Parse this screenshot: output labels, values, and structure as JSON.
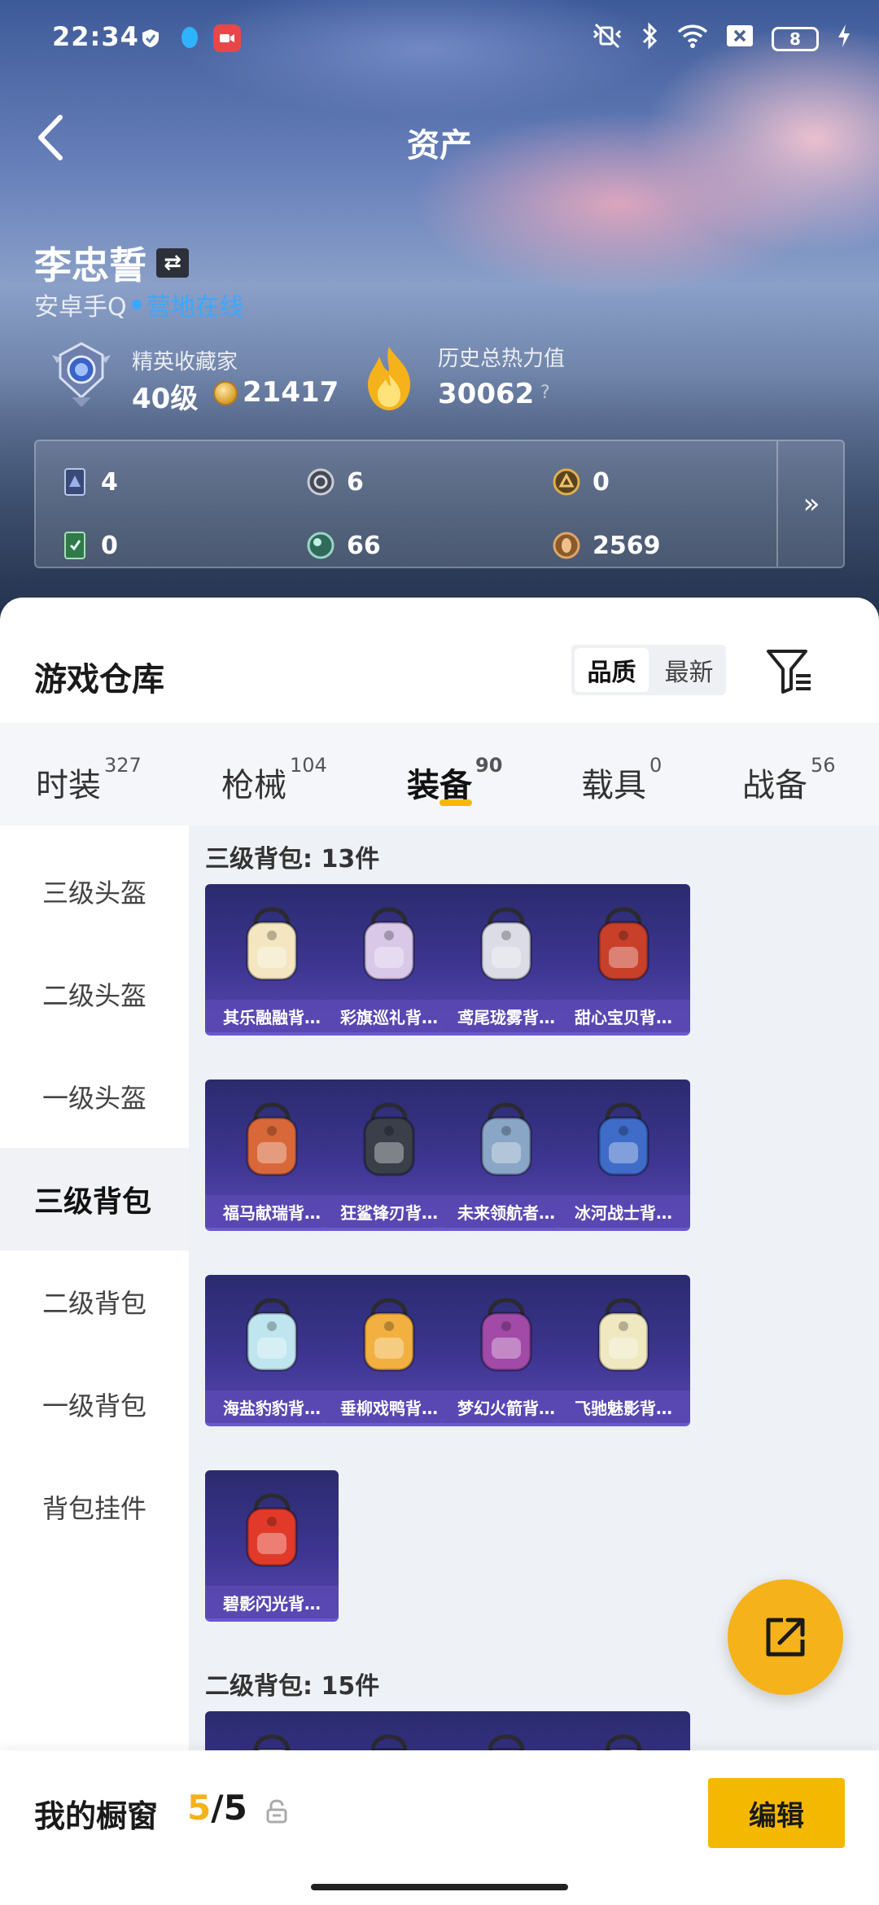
{
  "status_bar": {
    "time": "22:34",
    "battery": "8"
  },
  "header": {
    "title": "资产"
  },
  "user": {
    "name": "李忠誓",
    "platform": "安卓手Q",
    "online_label": "营地在线",
    "rank_label": "精英收藏家",
    "rank_level": "40级",
    "rank_points": "21417",
    "heat_label": "历史总热力值",
    "heat_value": "30062",
    "help": "?"
  },
  "stats": [
    {
      "icon": "card-icon",
      "value": "4"
    },
    {
      "icon": "silver-coin-icon",
      "value": "6"
    },
    {
      "icon": "gold-coin-icon",
      "value": "0"
    },
    {
      "icon": "green-ticket-icon",
      "value": "0"
    },
    {
      "icon": "orb-icon",
      "value": "66"
    },
    {
      "icon": "bronze-coin-icon",
      "value": "2569"
    }
  ],
  "warehouse": {
    "title": "游戏仓库",
    "sort": {
      "quality": "品质",
      "latest": "最新"
    },
    "tabs": [
      {
        "label": "时装",
        "count": "327"
      },
      {
        "label": "枪械",
        "count": "104"
      },
      {
        "label": "装备",
        "count": "90"
      },
      {
        "label": "载具",
        "count": "0"
      },
      {
        "label": "战备",
        "count": "56"
      }
    ],
    "categories": [
      "三级头盔",
      "二级头盔",
      "一级头盔",
      "三级背包",
      "二级背包",
      "一级背包",
      "背包挂件"
    ],
    "sections": [
      {
        "title": "三级背包: 13件",
        "items": [
          {
            "name": "其乐融融背…",
            "color": "#f3e6c0"
          },
          {
            "name": "彩旗巡礼背…",
            "color": "#d9c8e8"
          },
          {
            "name": "鸢尾珑雾背…",
            "color": "#dcdce6"
          },
          {
            "name": "甜心宝贝背…",
            "color": "#c8402a"
          },
          {
            "name": "福马献瑞背…",
            "color": "#d8683a"
          },
          {
            "name": "狂鲨锋刃背…",
            "color": "#3a3f4a"
          },
          {
            "name": "未来领航者…",
            "color": "#8aa6c6"
          },
          {
            "name": "冰河战士背…",
            "color": "#3e6cc8"
          },
          {
            "name": "海盐豹豹背…",
            "color": "#bfe6ee"
          },
          {
            "name": "垂柳戏鸭背…",
            "color": "#f2b040"
          },
          {
            "name": "梦幻火箭背…",
            "color": "#a24aa8"
          },
          {
            "name": "飞驰魅影背…",
            "color": "#efe8c0"
          },
          {
            "name": "碧影闪光背…",
            "color": "#e23a2a"
          }
        ]
      },
      {
        "title": "二级背包: 15件",
        "items": [
          {
            "name": "",
            "color": "#e8dcc0"
          },
          {
            "name": "",
            "color": "#3a3f4a"
          },
          {
            "name": "",
            "color": "#5a5a60"
          },
          {
            "name": "",
            "color": "#f0c8d8"
          }
        ]
      }
    ]
  },
  "showcase": {
    "title": "我的橱窗",
    "current": "5",
    "total": "/5",
    "edit": "编辑"
  }
}
